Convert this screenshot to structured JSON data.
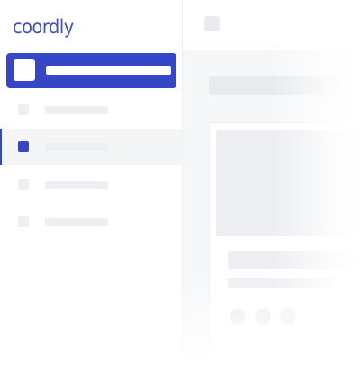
{
  "brand": {
    "logo_text": "coordly",
    "accent_color": "#3547c7"
  },
  "sidebar": {
    "items": [
      {
        "icon": "placeholder-icon",
        "state": "highlighted"
      },
      {
        "icon": "placeholder-icon",
        "state": "default"
      },
      {
        "icon": "placeholder-icon",
        "state": "selected"
      },
      {
        "icon": "placeholder-icon",
        "state": "default"
      },
      {
        "icon": "placeholder-icon",
        "state": "default"
      }
    ]
  },
  "topbar": {
    "icon": "placeholder-icon"
  },
  "colors": {
    "skeleton": "#edeff3",
    "content_bg": "#f6f7f9",
    "active": "#3547c7"
  }
}
